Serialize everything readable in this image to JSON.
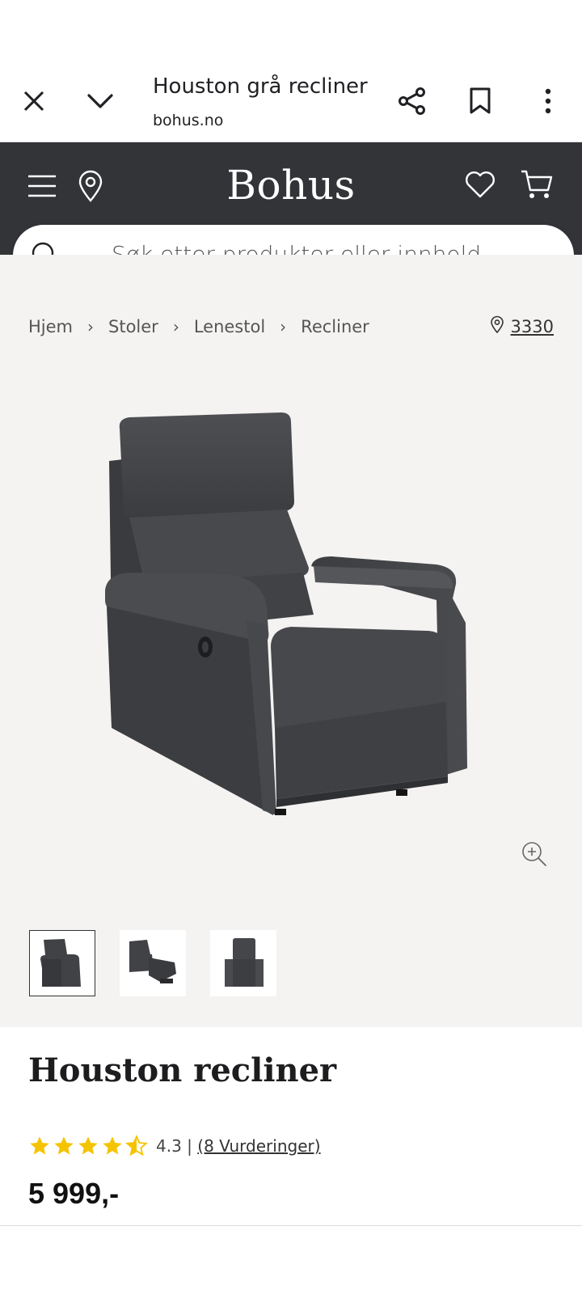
{
  "browser": {
    "page_title": "Houston grå recliner",
    "url": "bohus.no"
  },
  "site": {
    "logo": "Bohus",
    "search_placeholder": "Søk etter produkter eller innhold..."
  },
  "breadcrumb": [
    "Hjem",
    "Stoler",
    "Lenestol",
    "Recliner"
  ],
  "store_zip": "3330",
  "product": {
    "name": "Houston recliner",
    "rating": "4.3",
    "rating_separator": "|",
    "reviews": "(8 Vurderinger)",
    "rating_stars": 4.3,
    "price": "5 999,-"
  },
  "colors": {
    "header_bg": "#333438",
    "gallery_bg": "#f4f3f1",
    "star": "#f5c400"
  }
}
